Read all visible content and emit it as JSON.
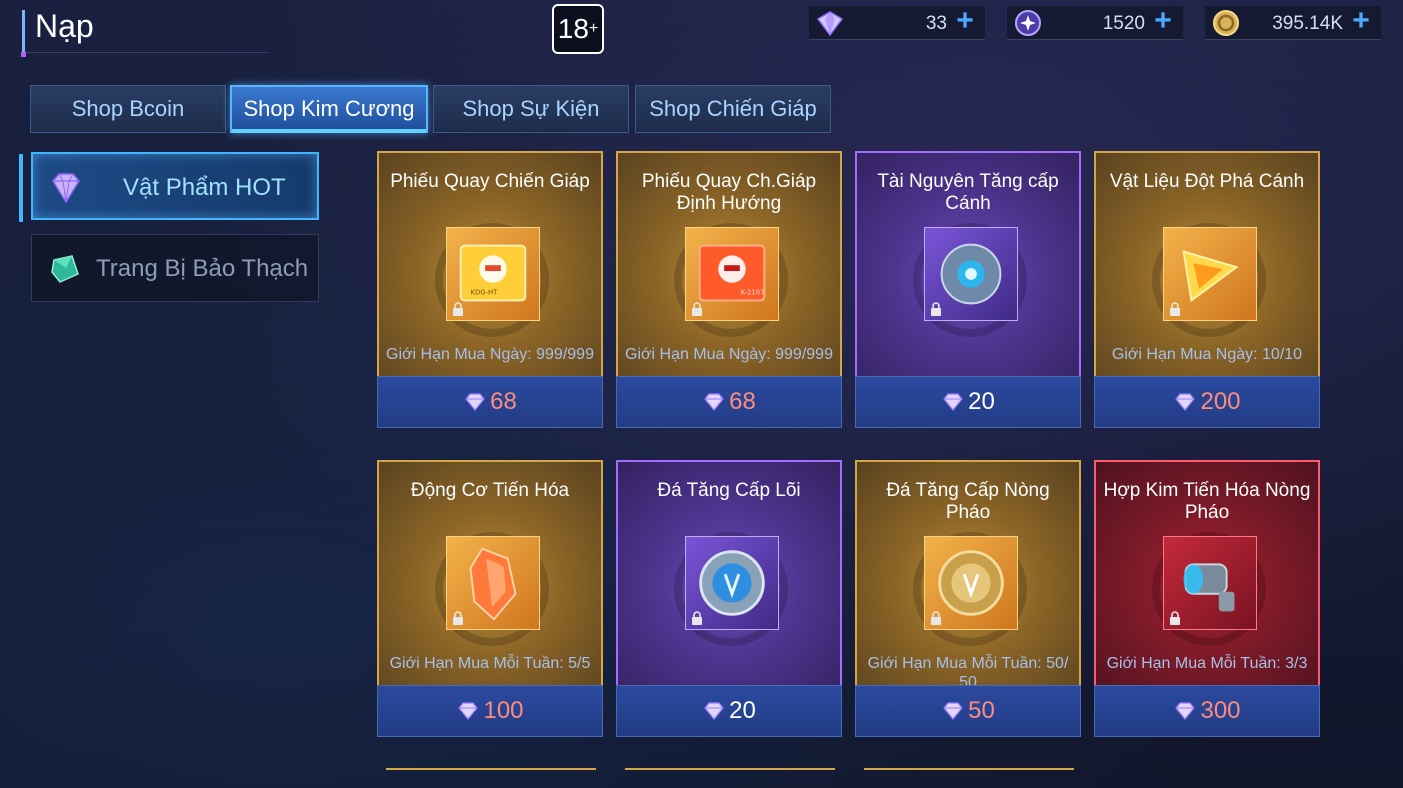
{
  "header": {
    "title": "Nạp",
    "age_rating": "18",
    "age_plus": "+"
  },
  "currencies": [
    {
      "icon": "diamond-icon",
      "value": "33"
    },
    {
      "icon": "star-orb-icon",
      "value": "1520"
    },
    {
      "icon": "gold-coin-icon",
      "value": "395.14K"
    }
  ],
  "tabs": [
    {
      "label": "Shop Bcoin",
      "active": false
    },
    {
      "label": "Shop Kim Cương",
      "active": true
    },
    {
      "label": "Shop Sự Kiện",
      "active": false
    },
    {
      "label": "Shop Chiến Giáp",
      "active": false
    }
  ],
  "sidebar": [
    {
      "label": "Vật Phẩm HOT",
      "icon": "diamond-icon",
      "active": true
    },
    {
      "label": "Trang Bị Bảo Thạch",
      "icon": "green-gem-icon",
      "active": false
    }
  ],
  "items": [
    {
      "name": "Phiếu Quay Chiến Giáp",
      "limit": "Giới Hạn Mua Ngày: 999/999",
      "price": "68",
      "rarity": "gold",
      "icon": "mecha-ticket-gold-icon"
    },
    {
      "name": "Phiếu Quay Ch.Giáp Định Hướng",
      "limit": "Giới Hạn Mua Ngày: 999/999",
      "price": "68",
      "rarity": "gold",
      "icon": "mecha-ticket-red-icon"
    },
    {
      "name": "Tài Nguyên Tăng cấp Cánh",
      "limit": "",
      "price": "20",
      "rarity": "purple",
      "icon": "wing-orb-icon"
    },
    {
      "name": "Vật Liệu Đột Phá Cánh",
      "limit": "Giới Hạn Mua Ngày: 10/10",
      "price": "200",
      "rarity": "gold",
      "icon": "breakthrough-crystal-icon"
    },
    {
      "name": "Động Cơ Tiến Hóa",
      "limit": "Giới Hạn Mua Mỗi Tuần: 5/5",
      "price": "100",
      "rarity": "gold",
      "icon": "evolution-engine-icon"
    },
    {
      "name": "Đá Tăng Cấp Lõi",
      "limit": "",
      "price": "20",
      "rarity": "purple",
      "icon": "core-stone-icon"
    },
    {
      "name": "Đá Tăng Cấp Nòng Pháo",
      "limit": "Giới Hạn Mua Mỗi Tuần: 50/ 50",
      "price": "50",
      "rarity": "gold",
      "icon": "cannon-stone-icon"
    },
    {
      "name": "Hợp Kim Tiến Hóa Nòng Pháo",
      "limit": "Giới Hạn Mua Mỗi Tuần: 3/3",
      "price": "300",
      "rarity": "red",
      "icon": "cannon-alloy-icon"
    }
  ],
  "colors": {
    "accent": "#3fb6ff",
    "gold": "#d4a646",
    "purple": "#a66cff",
    "red": "#ff5a6e",
    "price_hot": "#ff8c7a"
  }
}
